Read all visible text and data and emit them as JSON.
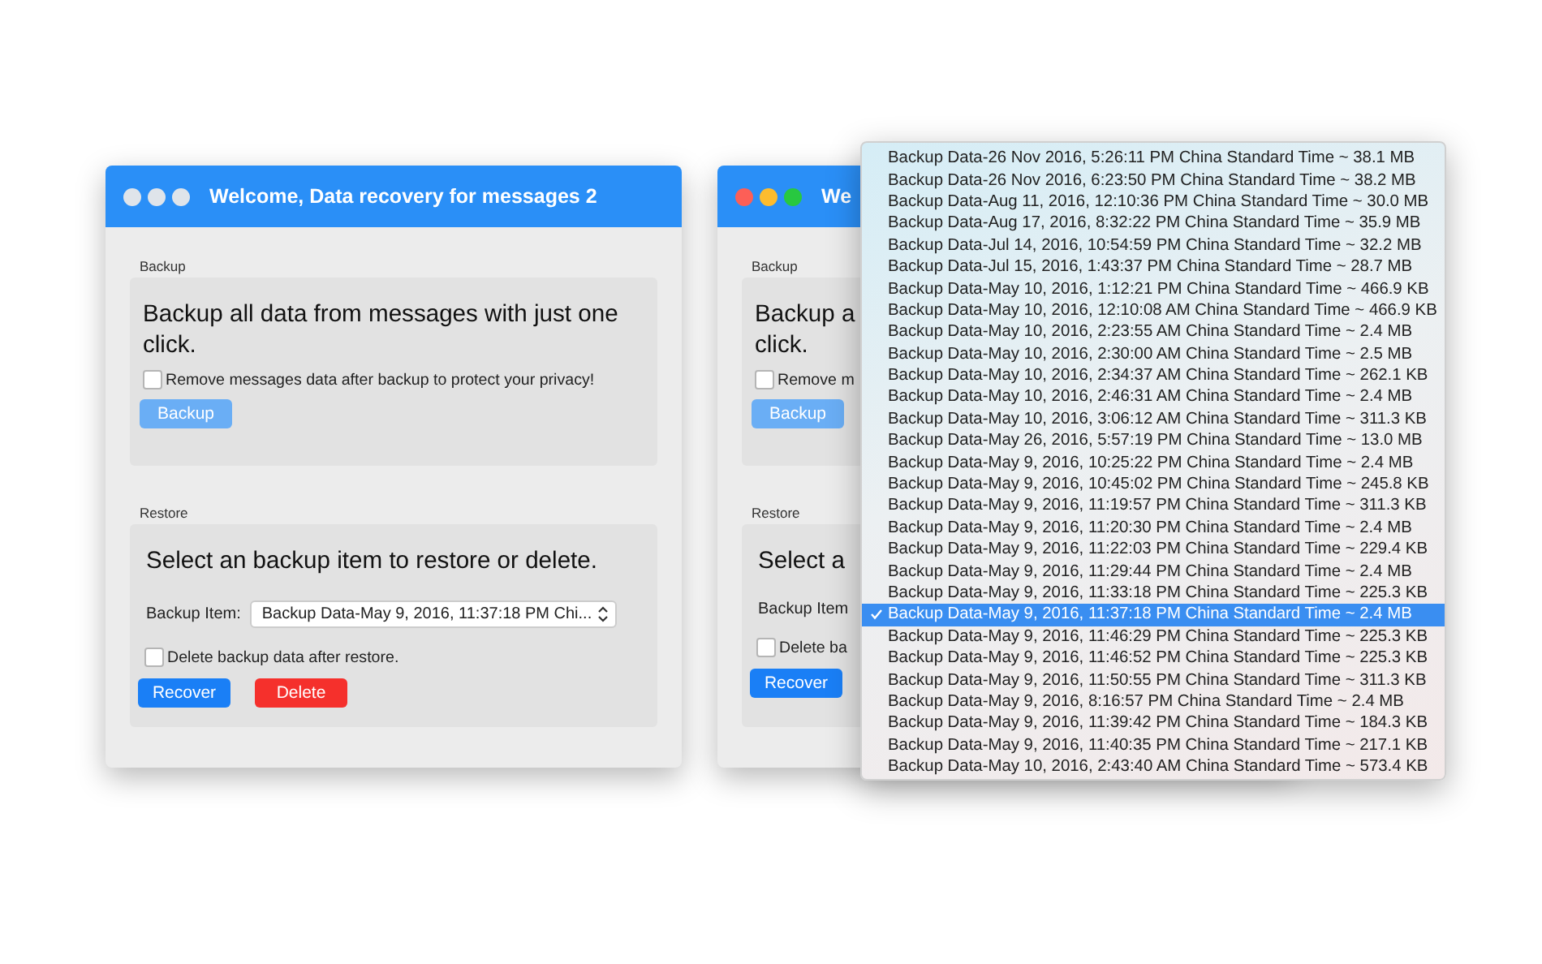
{
  "windows": [
    {
      "active": false,
      "title": "Welcome, Data recovery for messages 2",
      "backup": {
        "label": "Backup",
        "heading_lines": [
          "Backup all data from messages with just one",
          "click."
        ],
        "checkbox": {
          "label": "Remove messages data after backup to protect your privacy!",
          "checked": false
        },
        "button": "Backup"
      },
      "restore": {
        "label": "Restore",
        "heading_lines": [
          "Select an backup item to restore or delete."
        ],
        "field_label": "Backup Item:",
        "popup_value": "Backup Data-May 9, 2016, 11:37:18 PM Chi...",
        "checkbox": {
          "label": "Delete backup data after restore.",
          "checked": false
        },
        "buttons": [
          {
            "label": "Recover",
            "kind": "primary"
          },
          {
            "label": "Delete",
            "kind": "danger"
          }
        ]
      }
    },
    {
      "active": true,
      "title": "We",
      "backup": {
        "label": "Backup",
        "heading_lines": [
          "Backup a",
          "click."
        ],
        "checkbox": {
          "label": "Remove m",
          "checked": false
        },
        "button": "Backup"
      },
      "restore": {
        "label": "Restore",
        "heading_lines": [
          "Select a"
        ],
        "field_label": "Backup Item",
        "checkbox": {
          "label": "Delete ba",
          "checked": false
        },
        "buttons": [
          {
            "label": "Recover",
            "kind": "primary"
          }
        ]
      }
    }
  ],
  "popup_menu": {
    "items": [
      {
        "label": "Backup Data-26 Nov 2016, 5:26:11 PM China Standard Time ~ 38.1 MB",
        "selected": false
      },
      {
        "label": "Backup Data-26 Nov 2016, 6:23:50 PM China Standard Time ~ 38.2 MB",
        "selected": false
      },
      {
        "label": "Backup Data-Aug 11, 2016, 12:10:36 PM China Standard Time ~ 30.0 MB",
        "selected": false
      },
      {
        "label": "Backup Data-Aug 17, 2016, 8:32:22 PM China Standard Time ~ 35.9 MB",
        "selected": false
      },
      {
        "label": "Backup Data-Jul 14, 2016, 10:54:59 PM China Standard Time ~ 32.2 MB",
        "selected": false
      },
      {
        "label": "Backup Data-Jul 15, 2016, 1:43:37 PM China Standard Time ~ 28.7 MB",
        "selected": false
      },
      {
        "label": "Backup Data-May 10, 2016, 1:12:21 PM China Standard Time ~ 466.9 KB",
        "selected": false
      },
      {
        "label": "Backup Data-May 10, 2016, 12:10:08 AM China Standard Time ~ 466.9 KB",
        "selected": false
      },
      {
        "label": "Backup Data-May 10, 2016, 2:23:55 AM China Standard Time ~ 2.4 MB",
        "selected": false
      },
      {
        "label": "Backup Data-May 10, 2016, 2:30:00 AM China Standard Time ~ 2.5 MB",
        "selected": false
      },
      {
        "label": "Backup Data-May 10, 2016, 2:34:37 AM China Standard Time ~ 262.1 KB",
        "selected": false
      },
      {
        "label": "Backup Data-May 10, 2016, 2:46:31 AM China Standard Time ~ 2.4 MB",
        "selected": false
      },
      {
        "label": "Backup Data-May 10, 2016, 3:06:12 AM China Standard Time ~ 311.3 KB",
        "selected": false
      },
      {
        "label": "Backup Data-May 26, 2016, 5:57:19 PM China Standard Time ~ 13.0 MB",
        "selected": false
      },
      {
        "label": "Backup Data-May 9, 2016, 10:25:22 PM China Standard Time ~ 2.4 MB",
        "selected": false
      },
      {
        "label": "Backup Data-May 9, 2016, 10:45:02 PM China Standard Time ~ 245.8 KB",
        "selected": false
      },
      {
        "label": "Backup Data-May 9, 2016, 11:19:57 PM China Standard Time ~ 311.3 KB",
        "selected": false
      },
      {
        "label": "Backup Data-May 9, 2016, 11:20:30 PM China Standard Time ~ 2.4 MB",
        "selected": false
      },
      {
        "label": "Backup Data-May 9, 2016, 11:22:03 PM China Standard Time ~ 229.4 KB",
        "selected": false
      },
      {
        "label": "Backup Data-May 9, 2016, 11:29:44 PM China Standard Time ~ 2.4 MB",
        "selected": false
      },
      {
        "label": "Backup Data-May 9, 2016, 11:33:18 PM China Standard Time ~ 225.3 KB",
        "selected": false
      },
      {
        "label": "Backup Data-May 9, 2016, 11:37:18 PM China Standard Time ~ 2.4 MB",
        "selected": true
      },
      {
        "label": "Backup Data-May 9, 2016, 11:46:29 PM China Standard Time ~ 225.3 KB",
        "selected": false
      },
      {
        "label": "Backup Data-May 9, 2016, 11:46:52 PM China Standard Time ~ 225.3 KB",
        "selected": false
      },
      {
        "label": "Backup Data-May 9, 2016, 11:50:55 PM China Standard Time ~ 311.3 KB",
        "selected": false
      },
      {
        "label": "Backup Data-May 9, 2016, 8:16:57 PM China Standard Time ~ 2.4 MB",
        "selected": false
      },
      {
        "label": "Backup Data-May 9, 2016, 11:39:42 PM China Standard Time ~ 184.3 KB",
        "selected": false
      },
      {
        "label": "Backup Data-May 9, 2016, 11:40:35 PM China Standard Time ~ 217.1 KB",
        "selected": false
      },
      {
        "label": "Backup Data-May 10, 2016, 2:43:40 AM China Standard Time ~ 573.4 KB",
        "selected": false
      }
    ]
  }
}
